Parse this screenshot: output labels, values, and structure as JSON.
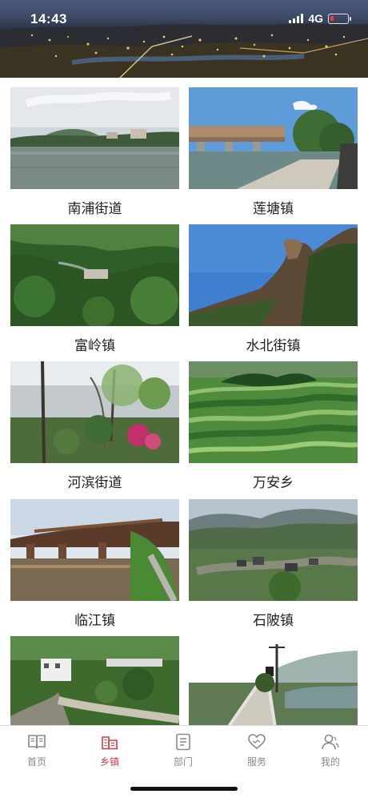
{
  "status_bar": {
    "time": "14:43",
    "network": "4G"
  },
  "towns": [
    {
      "name": "南浦街道"
    },
    {
      "name": "莲塘镇"
    },
    {
      "name": "富岭镇"
    },
    {
      "name": "水北街镇"
    },
    {
      "name": "河滨街道"
    },
    {
      "name": "万安乡"
    },
    {
      "name": "临江镇"
    },
    {
      "name": "石陂镇"
    },
    {
      "name": ""
    },
    {
      "name": ""
    }
  ],
  "tabbar": {
    "items": [
      {
        "label": "首页",
        "icon": "book-icon"
      },
      {
        "label": "乡镇",
        "icon": "town-icon"
      },
      {
        "label": "部门",
        "icon": "document-icon"
      },
      {
        "label": "服务",
        "icon": "heart-hand-icon"
      },
      {
        "label": "我的",
        "icon": "user-icon"
      }
    ],
    "active": "乡镇"
  },
  "colors": {
    "accent": "#d93a4a",
    "inactive": "#888888"
  }
}
